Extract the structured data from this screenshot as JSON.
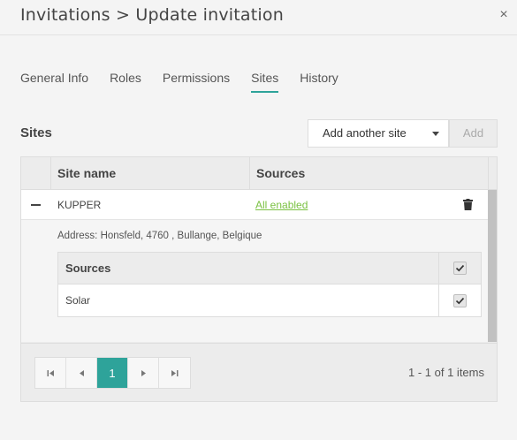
{
  "dialog": {
    "title": "Invitations > Update invitation",
    "close_glyph": "×"
  },
  "tabs": [
    {
      "label": "General Info",
      "active": false
    },
    {
      "label": "Roles",
      "active": false
    },
    {
      "label": "Permissions",
      "active": false
    },
    {
      "label": "Sites",
      "active": true
    },
    {
      "label": "History",
      "active": false
    }
  ],
  "sites_section": {
    "label": "Sites",
    "dropdown_value": "Add another site",
    "add_label": "Add"
  },
  "grid": {
    "columns": [
      "Site name",
      "Sources"
    ],
    "rows": [
      {
        "site_name": "KUPPER",
        "sources": "All enabled",
        "address": "Address: Honsfeld, 4760 , Bullange, Belgique",
        "detail": {
          "header": "Sources",
          "header_checked": true,
          "items": [
            {
              "name": "Solar",
              "checked": true
            }
          ]
        }
      }
    ]
  },
  "pager": {
    "current_page": "1",
    "info": "1 - 1 of 1 items"
  },
  "colors": {
    "accent": "#2ea39a",
    "link": "#7ac142"
  },
  "icons": [
    "close-icon",
    "caret-down-icon",
    "collapse-icon",
    "trash-icon",
    "checkmark-icon",
    "first-page-icon",
    "prev-page-icon",
    "next-page-icon",
    "last-page-icon"
  ]
}
